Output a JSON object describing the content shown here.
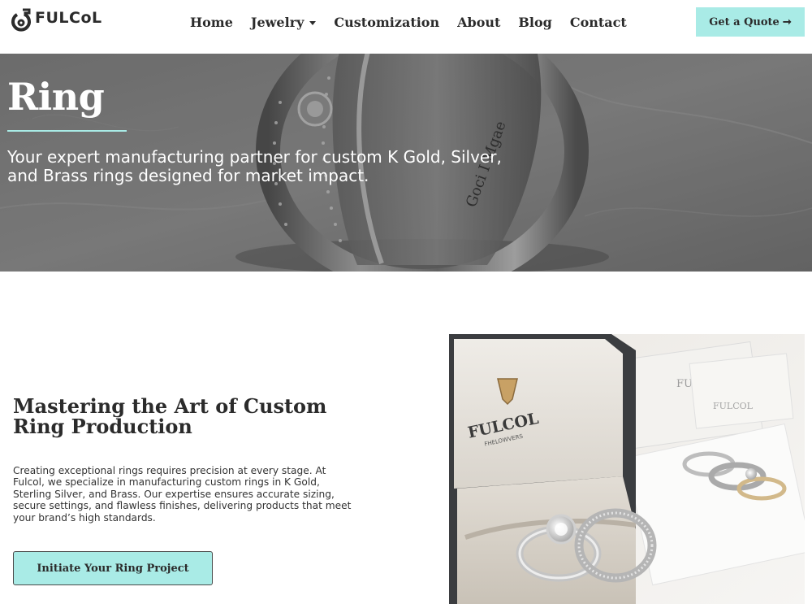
{
  "header": {
    "logo_text": "FULCoL",
    "nav": [
      {
        "label": "Home"
      },
      {
        "label": "Jewelry"
      },
      {
        "label": "Customization"
      },
      {
        "label": "About"
      },
      {
        "label": "Blog"
      },
      {
        "label": "Contact"
      }
    ],
    "quote_label": "Get a Quote",
    "quote_icon": "arrow-right-icon"
  },
  "hero": {
    "title": "Ring",
    "subtitle": "Your expert manufacturing partner for custom K Gold, Silver, and Brass rings designed for market impact.",
    "accent_color": "#a9ebe6",
    "ring_engraving": "Goci I Mgae"
  },
  "content": {
    "title": "Mastering the Art of Custom Ring Production",
    "body": "Creating exceptional rings requires precision at every stage. At Fulcol, we specialize in manufacturing custom rings in K Gold, Sterling Silver, and Brass. Our expertise ensures accurate sizing, secure settings, and flawless finishes, delivering products that meet your brand’s high standards.",
    "cta_label": "Initiate Your Ring Project"
  },
  "photo": {
    "brand": "FULCOL",
    "brand_sub": "FHELOWVERS",
    "card_text_1": "FULCOL",
    "card_text_2": "FULCOL"
  },
  "colors": {
    "accent": "#a9ebe6",
    "text": "#2b2b2b"
  }
}
